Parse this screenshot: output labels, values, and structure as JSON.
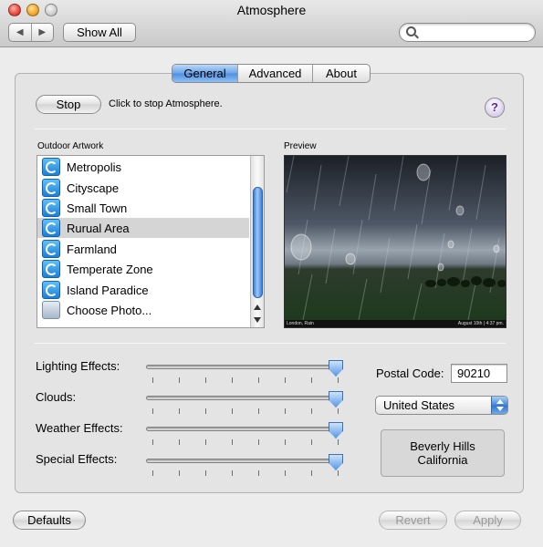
{
  "window": {
    "title": "Atmosphere"
  },
  "toolbar": {
    "back_label": "◀",
    "forward_label": "▶",
    "show_all_label": "Show All",
    "search_placeholder": ""
  },
  "tabs": [
    {
      "label": "General",
      "selected": true
    },
    {
      "label": "Advanced",
      "selected": false
    },
    {
      "label": "About",
      "selected": false
    }
  ],
  "controls": {
    "stop_label": "Stop",
    "stop_description": "Click to stop Atmosphere.",
    "help_label": "?"
  },
  "outdoor_artwork": {
    "heading": "Outdoor Artwork",
    "items": [
      {
        "label": "Metropolis",
        "icon": "atmosphere-icon"
      },
      {
        "label": "Cityscape",
        "icon": "atmosphere-icon"
      },
      {
        "label": "Small Town",
        "icon": "atmosphere-icon"
      },
      {
        "label": "Rurual Area",
        "icon": "atmosphere-icon",
        "selected": true
      },
      {
        "label": "Farmland",
        "icon": "atmosphere-icon"
      },
      {
        "label": "Temperate Zone",
        "icon": "atmosphere-icon"
      },
      {
        "label": "Island Paradice",
        "icon": "atmosphere-icon"
      },
      {
        "label": "Choose Photo...",
        "icon": "folder-icon"
      }
    ]
  },
  "preview": {
    "heading": "Preview",
    "caption_left": "London, Rain",
    "caption_right": "August 10th | 4:37 pm."
  },
  "sliders": [
    {
      "label": "Lighting Effects:",
      "value": 1.0
    },
    {
      "label": "Clouds:",
      "value": 1.0
    },
    {
      "label": "Weather Effects:",
      "value": 1.0
    },
    {
      "label": "Special Effects:",
      "value": 1.0
    }
  ],
  "location": {
    "postal_label": "Postal Code:",
    "postal_value": "90210",
    "country": "United States",
    "city_line1": "Beverly Hills",
    "city_line2": "California"
  },
  "footer": {
    "defaults_label": "Defaults",
    "revert_label": "Revert",
    "apply_label": "Apply"
  },
  "colors": {
    "selection": "#d5d5d5",
    "accent_blue": "#4c8ee0",
    "help_purple": "#5b2a96"
  }
}
